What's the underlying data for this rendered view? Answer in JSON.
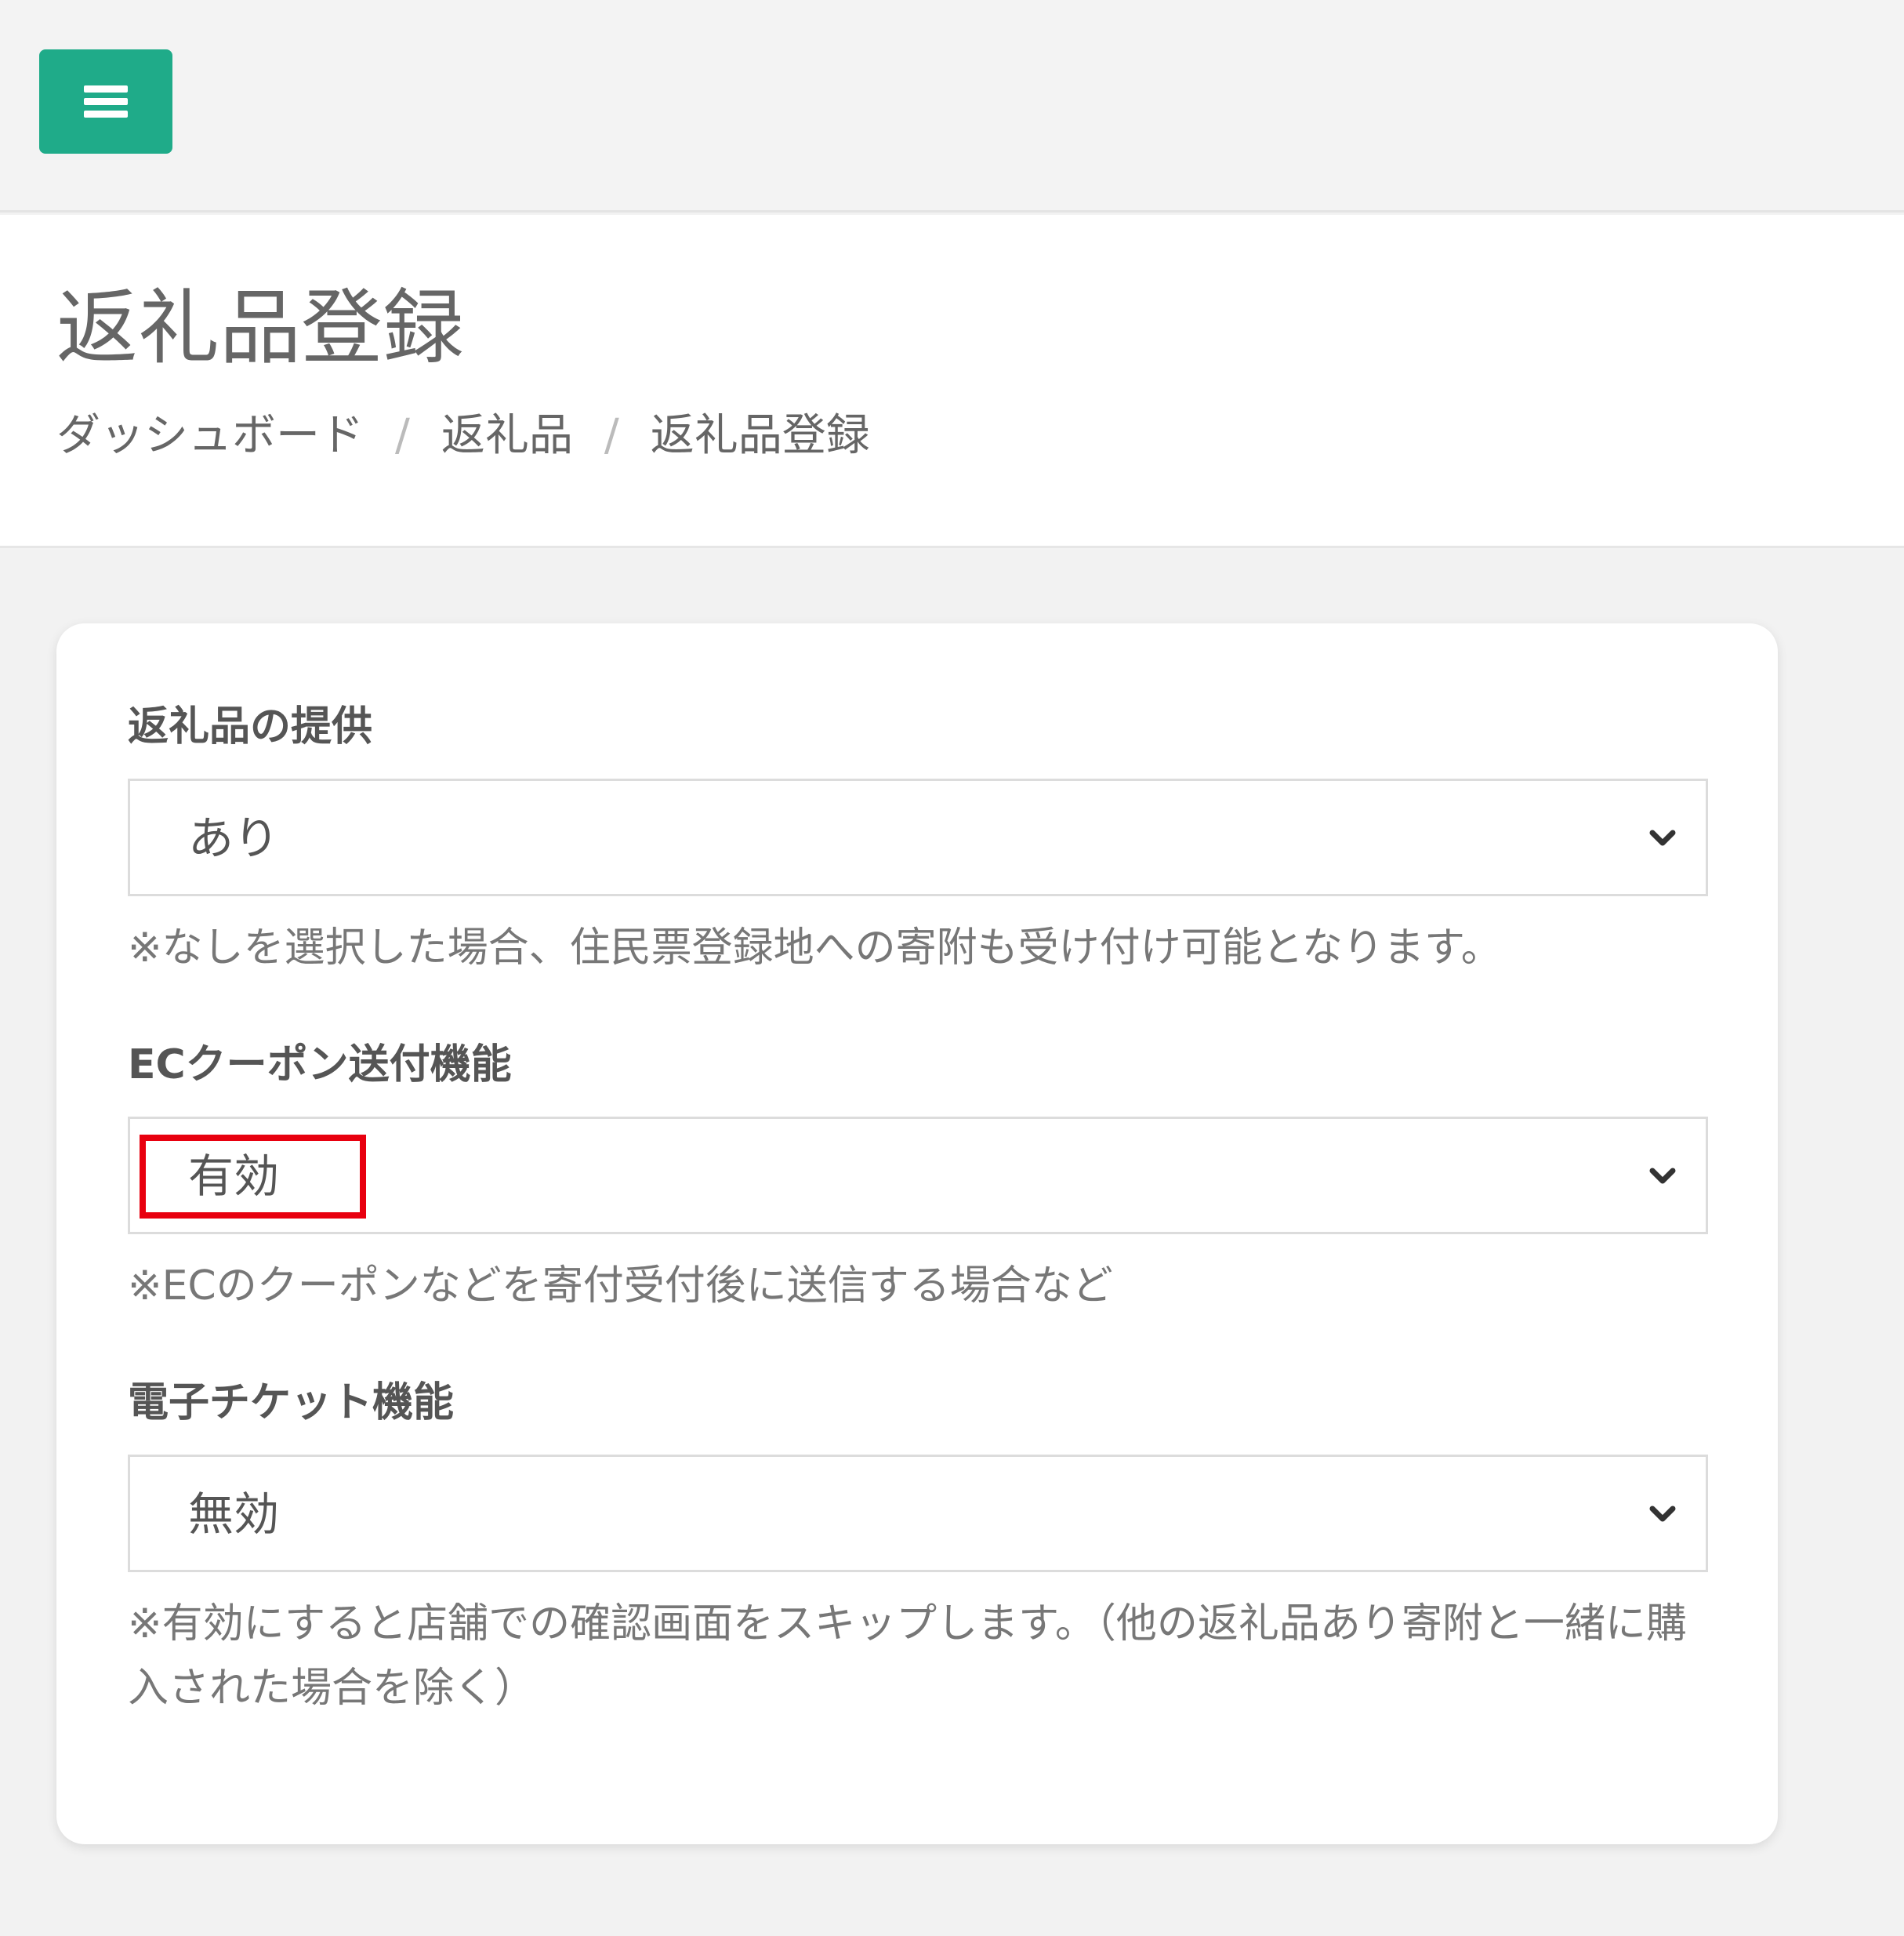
{
  "topbar": {
    "menu_icon": "hamburger-icon",
    "accent_color": "#1fab89"
  },
  "header": {
    "title": "返礼品登録",
    "breadcrumb": {
      "items": [
        "ダッシュボード",
        "返礼品",
        "返礼品登録"
      ],
      "separator": "/"
    }
  },
  "form": {
    "fields": [
      {
        "label": "返礼品の提供",
        "selected": "あり",
        "help": "※なしを選択した場合、住民票登録地への寄附も受け付け可能となります。"
      },
      {
        "label": "ECクーポン送付機能",
        "selected": "有効",
        "help": "※ECのクーポンなどを寄付受付後に送信する場合など",
        "highlighted": true,
        "highlight_color": "#e8000f"
      },
      {
        "label": "電子チケット機能",
        "selected": "無効",
        "help": "※有効にすると店舗での確認画面をスキップします。（他の返礼品あり寄附と一緒に購入された場合を除く）"
      }
    ]
  }
}
